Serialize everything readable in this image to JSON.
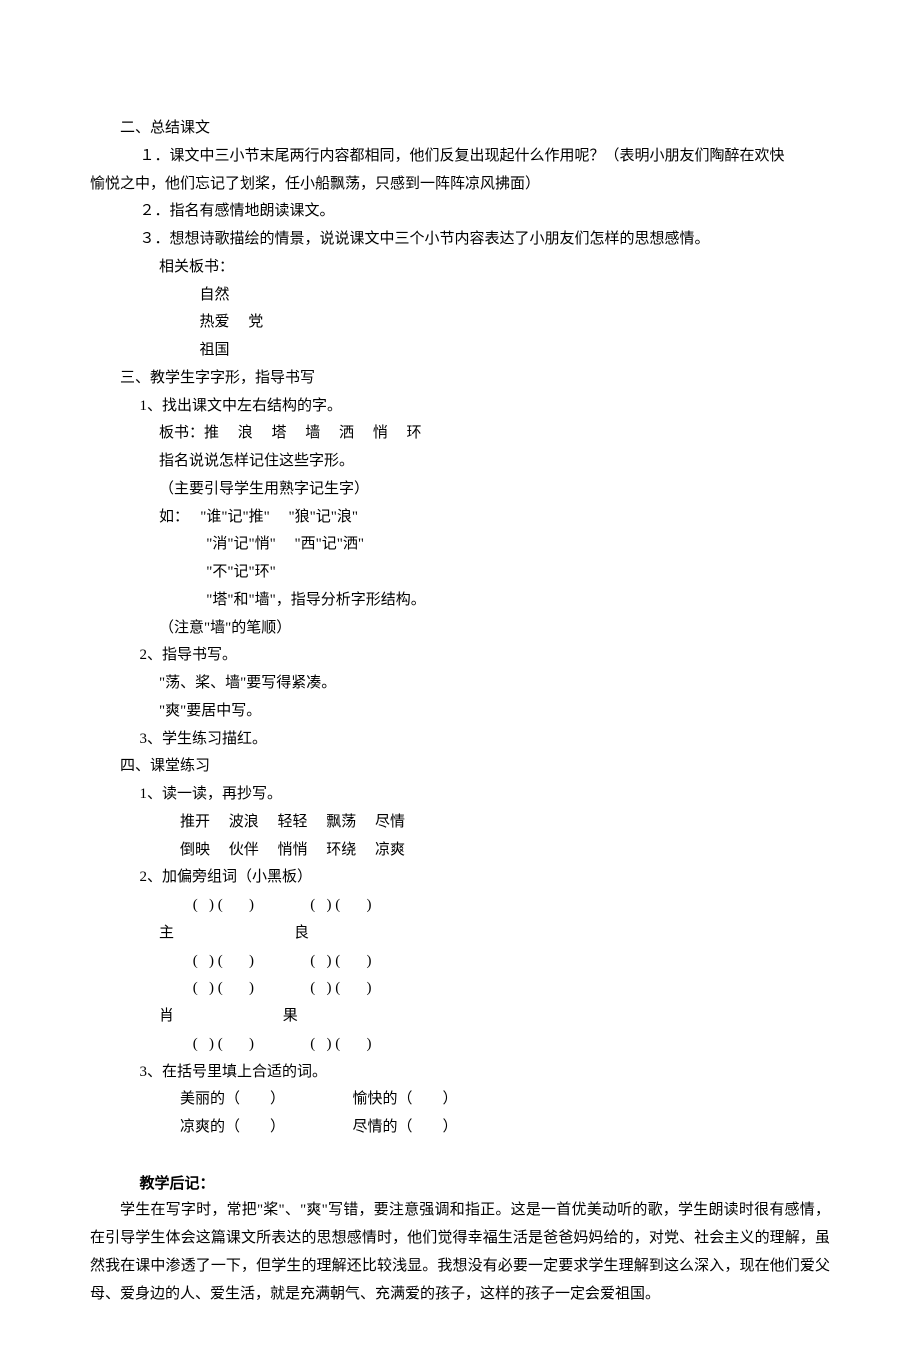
{
  "s2": {
    "h": "二、总结课文",
    "p1": "１．课文中三小节末尾两行内容都相同，他们反复出现起什么作用呢？（表明小朋友们陶醉在欢快",
    "p1b": "愉悦之中，他们忘记了划桨，任小船飘荡，只感到一阵阵凉风拂面）",
    "p2": "２．指名有感情地朗读课文。",
    "p3": "３．想想诗歌描绘的情景，说说课文中三个小节内容表达了小朋友们怎样的思想感情。",
    "bbh": "相关板书：",
    "bb1": "自然",
    "bb2": "热爱     党",
    "bb3": "祖国"
  },
  "s3": {
    "h": "三、教学生字字形，指导书写",
    "q1": "1、找出课文中左右结构的字。",
    "q1a": "板书：推     浪     塔     墙     洒     悄     环",
    "q1b": "指名说说怎样记住这些字形。",
    "q1c": "（主要引导学生用熟字记生字）",
    "q1d": "如：   \"谁\"记\"推\"     \"狼\"记\"浪\"",
    "q1e": "       \"消\"记\"悄\"     \"西\"记\"洒\"",
    "q1f": "       \"不\"记\"环\"",
    "q1g": "       \"塔\"和\"墙\"，指导分析字形结构。",
    "q1h": "（注意\"墙\"的笔顺）",
    "q2": "2、指导书写。",
    "q2a": "\"荡、桨、墙\"要写得紧凑。",
    "q2b": "\"爽\"要居中写。",
    "q3": "3、学生练习描红。"
  },
  "s4": {
    "h": "四、课堂练习",
    "q1": "1、读一读，再抄写。",
    "q1a": "推开     波浪     轻轻     飘荡     尽情",
    "q1b": "倒映     伙伴     悄悄     环绕     凉爽",
    "q2": "2、加偏旁组词（小黑板）",
    "gA": "         (   ) (       )               (   ) (       )",
    "gB": "主                                良",
    "gC": "         (   ) (       )               (   ) (       )",
    "gD": "         (   ) (       )               (   ) (       )",
    "gE": "肖                             果",
    "gF": "         (   ) (       )               (   ) (       )",
    "q3": "3、在括号里填上合适的词。",
    "q3a": "美丽的（        ）                  愉快的（        ）",
    "q3b": "凉爽的（        ）                  尽情的（        ）"
  },
  "notes": {
    "h": "教学后记：",
    "p": "学生在写字时，常把\"桨\"、\"爽\"写错，要注意强调和指正。这是一首优美动听的歌，学生朗读时很有感情，在引导学生体会这篇课文所表达的思想感情时，他们觉得幸福生活是爸爸妈妈给的，对党、社会主义的理解，虽然我在课中渗透了一下，但学生的理解还比较浅显。我想没有必要一定要求学生理解到这么深入，现在他们爱父母、爱身边的人、爱生活，就是充满朝气、充满爱的孩子，这样的孩子一定会爱祖国。"
  }
}
